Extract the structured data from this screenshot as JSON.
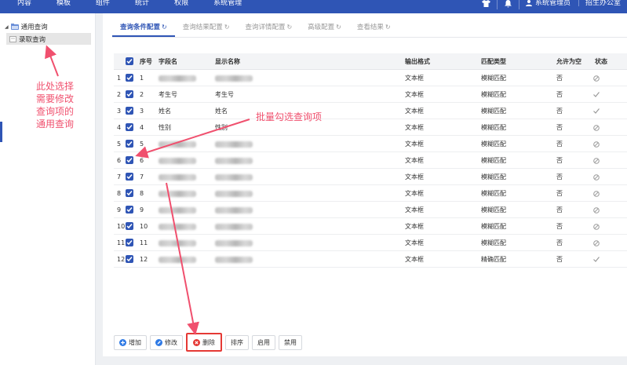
{
  "topbar": {
    "nav": [
      "内容",
      "模板",
      "组件",
      "统计",
      "权限",
      "系统管理"
    ],
    "user": "系统管理员",
    "dept": "招生办公室",
    "icons": [
      "shirt-icon",
      "bell-icon",
      "user-icon"
    ]
  },
  "sidebar": {
    "root_label": "通用查询",
    "child_label": "录取查询"
  },
  "tabs": [
    {
      "label": "查询条件配置",
      "active": true
    },
    {
      "label": "查询结果配置",
      "active": false
    },
    {
      "label": "查询详情配置",
      "active": false
    },
    {
      "label": "高级配置",
      "active": false
    },
    {
      "label": "查看结果",
      "active": false
    }
  ],
  "table": {
    "columns": [
      "序号",
      "字段名",
      "显示名称",
      "输出格式",
      "匹配类型",
      "允许为空",
      "状态"
    ],
    "rows": [
      {
        "n": "1",
        "seq": "1",
        "field": "",
        "display": "",
        "fmt": "文本框",
        "match": "模糊匹配",
        "null": "否",
        "status": "disabled"
      },
      {
        "n": "2",
        "seq": "2",
        "field": "考生号",
        "display": "考生号",
        "fmt": "文本框",
        "match": "模糊匹配",
        "null": "否",
        "status": "enabled"
      },
      {
        "n": "3",
        "seq": "3",
        "field": "姓名",
        "display": "姓名",
        "fmt": "文本框",
        "match": "模糊匹配",
        "null": "否",
        "status": "enabled"
      },
      {
        "n": "4",
        "seq": "4",
        "field": "性别",
        "display": "性别",
        "fmt": "文本框",
        "match": "模糊匹配",
        "null": "否",
        "status": "disabled"
      },
      {
        "n": "5",
        "seq": "5",
        "field": "",
        "display": "",
        "fmt": "文本框",
        "match": "模糊匹配",
        "null": "否",
        "status": "disabled"
      },
      {
        "n": "6",
        "seq": "6",
        "field": "",
        "display": "",
        "fmt": "文本框",
        "match": "模糊匹配",
        "null": "否",
        "status": "disabled"
      },
      {
        "n": "7",
        "seq": "7",
        "field": "",
        "display": "",
        "fmt": "文本框",
        "match": "模糊匹配",
        "null": "否",
        "status": "disabled"
      },
      {
        "n": "8",
        "seq": "8",
        "field": "",
        "display": "",
        "fmt": "文本框",
        "match": "模糊匹配",
        "null": "否",
        "status": "disabled"
      },
      {
        "n": "9",
        "seq": "9",
        "field": "",
        "display": "",
        "fmt": "文本框",
        "match": "模糊匹配",
        "null": "否",
        "status": "disabled"
      },
      {
        "n": "10",
        "seq": "10",
        "field": "",
        "display": "",
        "fmt": "文本框",
        "match": "模糊匹配",
        "null": "否",
        "status": "disabled"
      },
      {
        "n": "11",
        "seq": "11",
        "field": "",
        "display": "",
        "fmt": "文本框",
        "match": "模糊匹配",
        "null": "否",
        "status": "disabled"
      },
      {
        "n": "12",
        "seq": "12",
        "field": "",
        "display": "",
        "fmt": "文本框",
        "match": "精确匹配",
        "null": "否",
        "status": "enabled"
      }
    ]
  },
  "toolbar": {
    "add": "增加",
    "edit": "修改",
    "delete": "删除",
    "sort": "排序",
    "enable": "启用",
    "disable": "禁用"
  },
  "annotations": {
    "select_query": "此处选择\n需要修改\n查询项的\n通用查询",
    "batch_check": "批量勾选查询项"
  },
  "colors": {
    "brand": "#2f55b5",
    "annotation": "#f0506e",
    "delete_highlight": "#e53935"
  }
}
